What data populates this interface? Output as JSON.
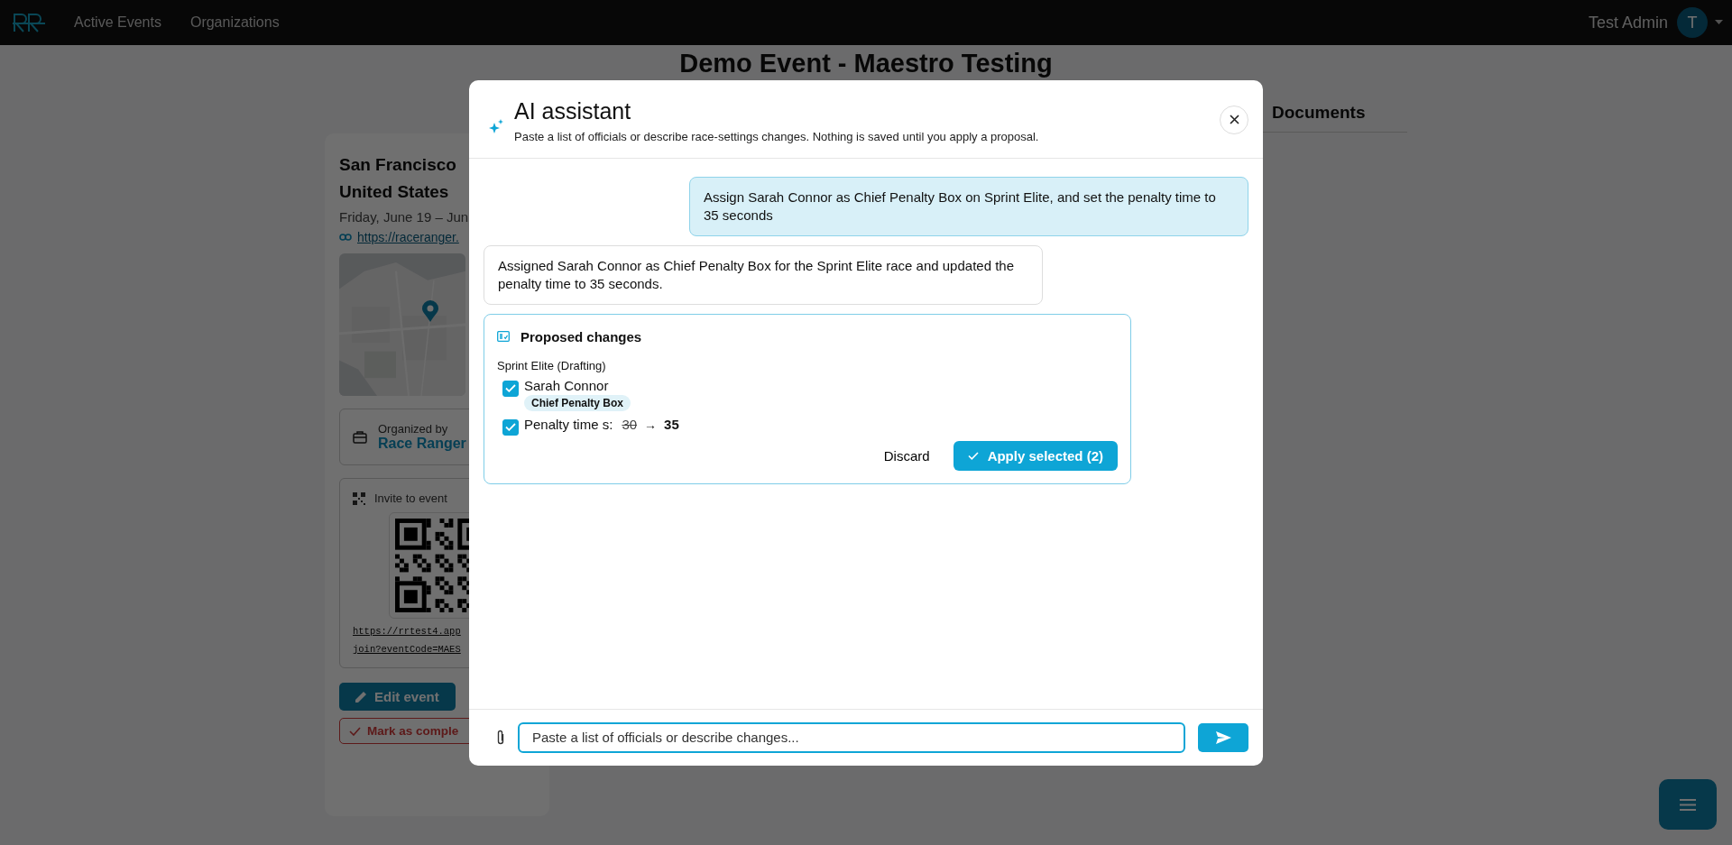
{
  "nav": {
    "items": [
      {
        "label": "Active Events",
        "selected": false
      },
      {
        "label": "Organizations",
        "selected": false
      }
    ],
    "user": {
      "name": "Test Admin",
      "initial": "T"
    }
  },
  "page": {
    "title": "Demo Event - Maestro Testing",
    "tab": "Documents"
  },
  "event_card": {
    "title_lines": [
      "San Francisco",
      "United States"
    ],
    "dates": "Friday, June 19 – Jun",
    "link": "https://raceranger.",
    "organizer_label": "Organized by",
    "organizer": "Race Ranger",
    "invite_label": "Invite to event",
    "invite_url_lines": [
      "https://rrtest4.app",
      "join?eventCode=MAES"
    ],
    "edit_button": "Edit event",
    "complete_button": "Mark as comple"
  },
  "modal": {
    "title": "AI assistant",
    "subtitle": "Paste a list of officials or describe race-settings changes. Nothing is saved until you apply a proposal.",
    "messages": [
      {
        "kind": "user",
        "text": "Assign Sarah Connor as Chief Penalty Box on Sprint Elite, and set the penalty time to 35 seconds"
      },
      {
        "kind": "assistant",
        "text": "Assigned Sarah Connor as Chief Penalty Box for the Sprint Elite race and updated the penalty time to 35 seconds."
      }
    ],
    "proposal": {
      "title": "Proposed changes",
      "group": "Sprint Elite (Drafting)",
      "changes": [
        {
          "kind": "official",
          "checked": true,
          "name": "Sarah Connor",
          "role": "Chief Penalty Box"
        },
        {
          "kind": "setting",
          "checked": true,
          "label": "Penalty time s:",
          "old": "30",
          "arrow": "→",
          "new": "35"
        }
      ],
      "discard": "Discard",
      "apply": "Apply selected (2)"
    },
    "input": {
      "placeholder": "Paste a list of officials or describe changes..."
    }
  }
}
